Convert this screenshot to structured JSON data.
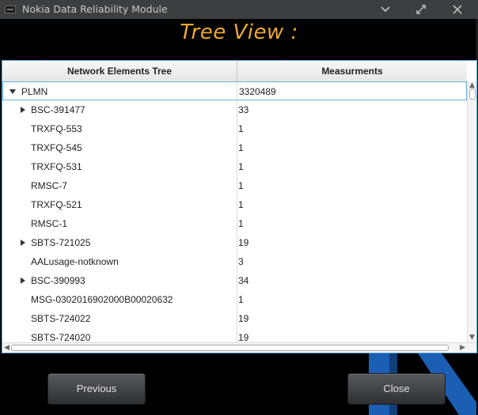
{
  "window": {
    "title": "Nokia Data Reliability Module"
  },
  "header": {
    "title": "Tree View :"
  },
  "table": {
    "columns": [
      "Network Elements Tree",
      "Measurments"
    ],
    "rows": [
      {
        "name": "PLMN",
        "value": "3320489",
        "expander": "expanded",
        "level": 0
      },
      {
        "name": "BSC-391477",
        "value": "33",
        "expander": "collapsed",
        "level": 1
      },
      {
        "name": "TRXFQ-553",
        "value": "1",
        "expander": "none",
        "level": 1
      },
      {
        "name": "TRXFQ-545",
        "value": "1",
        "expander": "none",
        "level": 1
      },
      {
        "name": "TRXFQ-531",
        "value": "1",
        "expander": "none",
        "level": 1
      },
      {
        "name": "RMSC-7",
        "value": "1",
        "expander": "none",
        "level": 1
      },
      {
        "name": "TRXFQ-521",
        "value": "1",
        "expander": "none",
        "level": 1
      },
      {
        "name": "RMSC-1",
        "value": "1",
        "expander": "none",
        "level": 1
      },
      {
        "name": "SBTS-721025",
        "value": "19",
        "expander": "collapsed",
        "level": 1
      },
      {
        "name": "AALusage-notknown",
        "value": "3",
        "expander": "none",
        "level": 1
      },
      {
        "name": "BSC-390993",
        "value": "34",
        "expander": "collapsed",
        "level": 1
      },
      {
        "name": "MSG-0302016902000B00020632",
        "value": "1",
        "expander": "none",
        "level": 1
      },
      {
        "name": "SBTS-724022",
        "value": "19",
        "expander": "none",
        "level": 1
      },
      {
        "name": "SBTS-724020",
        "value": "19",
        "expander": "none",
        "level": 1
      }
    ]
  },
  "buttons": {
    "previous": "Previous",
    "close": "Close"
  },
  "colors": {
    "title_accent": "#f0a833",
    "logo_blue": "#1a5fb4"
  }
}
